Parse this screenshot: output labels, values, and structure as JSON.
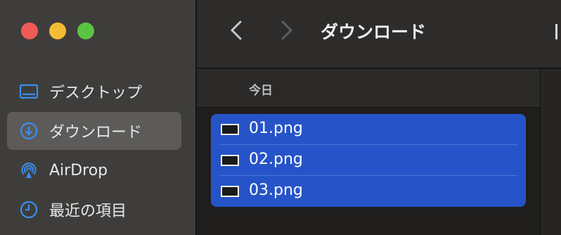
{
  "window": {
    "title": "ダウンロード"
  },
  "sidebar": {
    "items": [
      {
        "label": "デスクトップ",
        "icon": "desktop-icon",
        "selected": false
      },
      {
        "label": "ダウンロード",
        "icon": "download-icon",
        "selected": true
      },
      {
        "label": "AirDrop",
        "icon": "airdrop-icon",
        "selected": false
      },
      {
        "label": "最近の項目",
        "icon": "clock-icon",
        "selected": false
      }
    ]
  },
  "list": {
    "group_header": "今日",
    "files": [
      {
        "name": "01.png",
        "selected": true
      },
      {
        "name": "02.png",
        "selected": true
      },
      {
        "name": "03.png",
        "selected": true
      }
    ]
  },
  "colors": {
    "accent": "#2654c8",
    "sidebar_icon": "#3b8ff0",
    "close": "#ec5b57",
    "minimize": "#f2bd34",
    "zoom": "#5bc444"
  }
}
